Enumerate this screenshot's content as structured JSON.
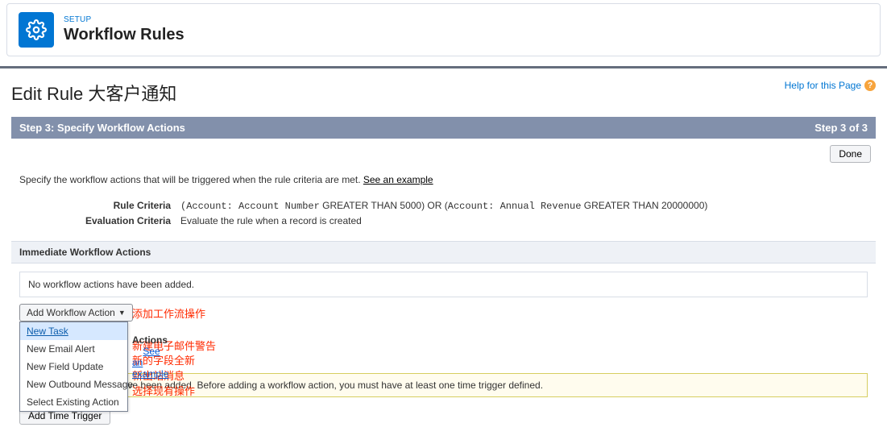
{
  "header": {
    "setup_label": "SETUP",
    "title": "Workflow Rules"
  },
  "page": {
    "title": "Edit Rule 大客户通知",
    "help_link": "Help for this Page"
  },
  "step_bar": {
    "left": "Step 3:  Specify Workflow Actions",
    "right": "Step 3 of 3"
  },
  "buttons": {
    "done": "Done",
    "add_workflow_action": "Add Workflow Action",
    "add_time_trigger": "Add Time Trigger"
  },
  "instruction": {
    "text": "Specify the workflow actions that will be triggered when the rule criteria are met. ",
    "link": "See an example"
  },
  "criteria": {
    "rule_label": "Rule Criteria",
    "rule_value_p1": "(Account: Account Number",
    "rule_value_p2": " GREATER THAN 5000) OR (",
    "rule_value_p3": "Account: Annual Revenue",
    "rule_value_p4": " GREATER THAN 20000000)",
    "eval_label": "Evaluation Criteria",
    "eval_value": "Evaluate the rule when a record is created"
  },
  "sections": {
    "immediate": "Immediate Workflow Actions",
    "time_dependent": "Time-Dependent Workflow Actions",
    "see_example": "See an example"
  },
  "empty_msg": "No workflow actions have been added.",
  "dropdown": {
    "items": [
      "New Task",
      "New Email Alert",
      "New Field Update",
      "New Outbound Message",
      "Select Existing Action"
    ]
  },
  "annotations": {
    "add_action": "添加工作流操作",
    "new_email": "新建电子邮件警告",
    "new_field": "新的字段全新",
    "new_outbound": "新出站消息",
    "select_existing": "选择现有操作"
  },
  "warning": "No workflow actions have been added. Before adding a workflow action, you must have at least one time trigger defined."
}
